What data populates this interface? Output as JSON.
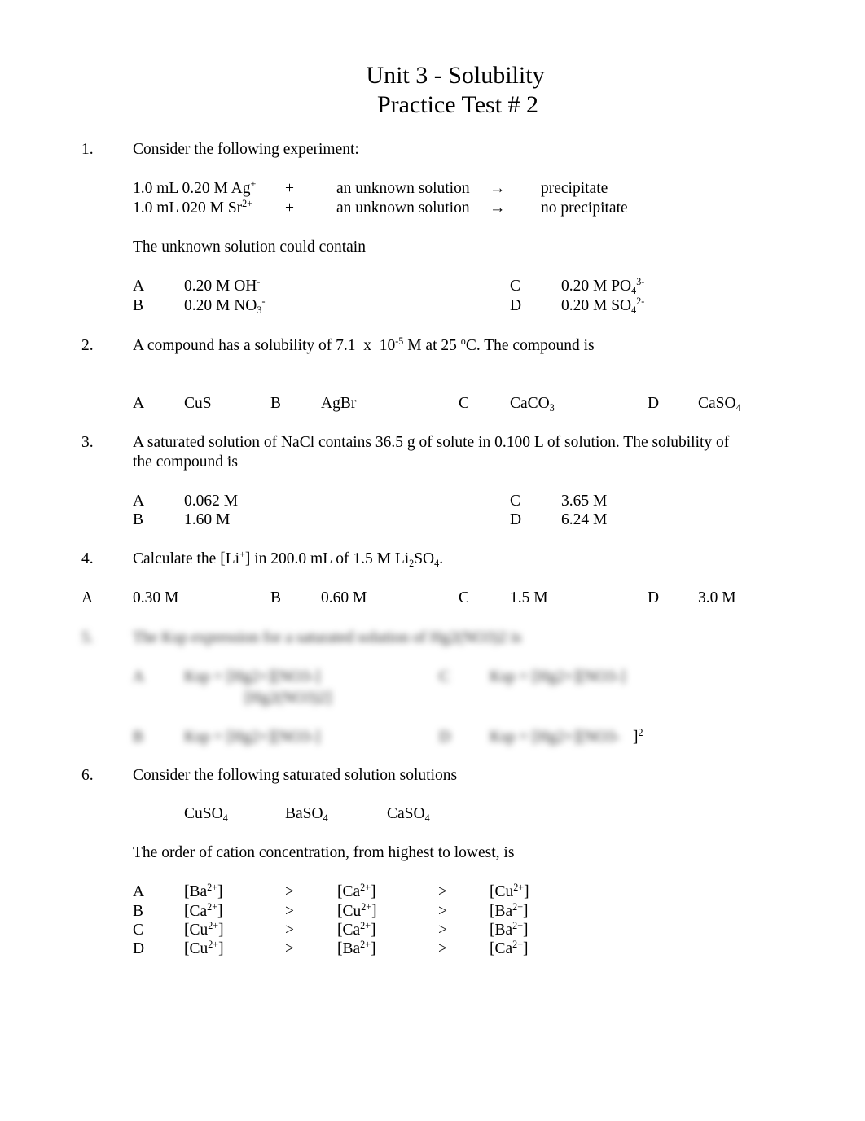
{
  "title": {
    "line1": "Unit 3 - Solubility",
    "line2": "Practice Test # 2"
  },
  "questions": [
    {
      "number": "1.",
      "prompt": "Consider the following experiment:",
      "experiment": [
        {
          "reactant": "1.0 mL 0.20 M Ag",
          "reactant_sup": "+",
          "plus": "+",
          "reagent": "an unknown solution",
          "arrow": "→",
          "result": "precipitate"
        },
        {
          "reactant": "1.0 mL 020 M Sr",
          "reactant_sup": "2+",
          "plus": "+",
          "reagent": "an unknown solution",
          "arrow": "→",
          "result": "no precipitate"
        }
      ],
      "followup": "The unknown solution could contain",
      "options": [
        {
          "letter": "A",
          "text": "0.20 M OH",
          "sub": "",
          "sup": "-"
        },
        {
          "letter": "B",
          "text": "0.20 M NO",
          "sub": "3",
          "sup": "-"
        },
        {
          "letter": "C",
          "text": "0.20 M PO",
          "sub": "4",
          "sup": "3-"
        },
        {
          "letter": "D",
          "text": "0.20 M SO",
          "sub": "4",
          "sup": "2-"
        }
      ]
    },
    {
      "number": "2.",
      "prompt_pre": "A compound has a solubility of 7.1  x  10",
      "prompt_exp": "-5",
      "prompt_mid": " M at 25 ",
      "prompt_deg": "o",
      "prompt_post": "C. The compound is",
      "options": [
        {
          "letter": "A",
          "text": "CuS",
          "sub": ""
        },
        {
          "letter": "B",
          "text": "AgBr",
          "sub": ""
        },
        {
          "letter": "C",
          "text": "CaCO",
          "sub": "3"
        },
        {
          "letter": "D",
          "text": "CaSO",
          "sub": "4"
        }
      ]
    },
    {
      "number": "3.",
      "prompt_line1": "A saturated solution of NaCl contains 36.5 g of solute in 0.100 L of solution. The solubility of",
      "prompt_line2": "the compound is",
      "options": [
        {
          "letter": "A",
          "text": "0.062 M"
        },
        {
          "letter": "B",
          "text": "1.60 M"
        },
        {
          "letter": "C",
          "text": "3.65 M"
        },
        {
          "letter": "D",
          "text": "6.24 M"
        }
      ]
    },
    {
      "number": "4.",
      "prompt_pre": "Calculate the [Li",
      "prompt_sup": "+",
      "prompt_mid": "] in 200.0 mL of 1.5 M Li",
      "prompt_sub1": "2",
      "prompt_mid2": "SO",
      "prompt_sub2": "4",
      "prompt_post": ".",
      "options": [
        {
          "letter": "A",
          "text": "0.30 M"
        },
        {
          "letter": "B",
          "text": "0.60 M"
        },
        {
          "letter": "C",
          "text": "1.5 M"
        },
        {
          "letter": "D",
          "text": "3.0 M"
        }
      ]
    },
    {
      "number": "5.",
      "blurred": true,
      "prompt": "The Ksp expression for a saturated solution of Hg2(NO3)2 is",
      "options": [
        {
          "letter": "A",
          "text": "Ksp = [Hg2+][NO3-]",
          "denominator": "[Hg2(NO3)2]"
        },
        {
          "letter": "B",
          "text": "Ksp = [Hg2+][NO3-]"
        },
        {
          "letter": "C",
          "text": "Ksp = [Hg2+][NO3-]"
        },
        {
          "letter": "D",
          "text": "Ksp = [Hg2+][NO3-",
          "visible_tail": "]",
          "visible_tail_sup": "2"
        }
      ]
    },
    {
      "number": "6.",
      "prompt": "Consider the following saturated solution solutions",
      "compounds": [
        {
          "text": "CuSO",
          "sub": "4"
        },
        {
          "text": "BaSO",
          "sub": "4"
        },
        {
          "text": "CaSO",
          "sub": "4"
        }
      ],
      "followup": "The order of cation concentration, from highest to lowest, is",
      "gt": ">",
      "ion_charge": "2+",
      "options": [
        {
          "letter": "A",
          "ions": [
            "Ba",
            "Ca",
            "Cu"
          ]
        },
        {
          "letter": "B",
          "ions": [
            "Ca",
            "Cu",
            "Ba"
          ]
        },
        {
          "letter": "C",
          "ions": [
            "Cu",
            "Ca",
            "Ba"
          ]
        },
        {
          "letter": "D",
          "ions": [
            "Cu",
            "Ba",
            "Ca"
          ]
        }
      ]
    }
  ]
}
